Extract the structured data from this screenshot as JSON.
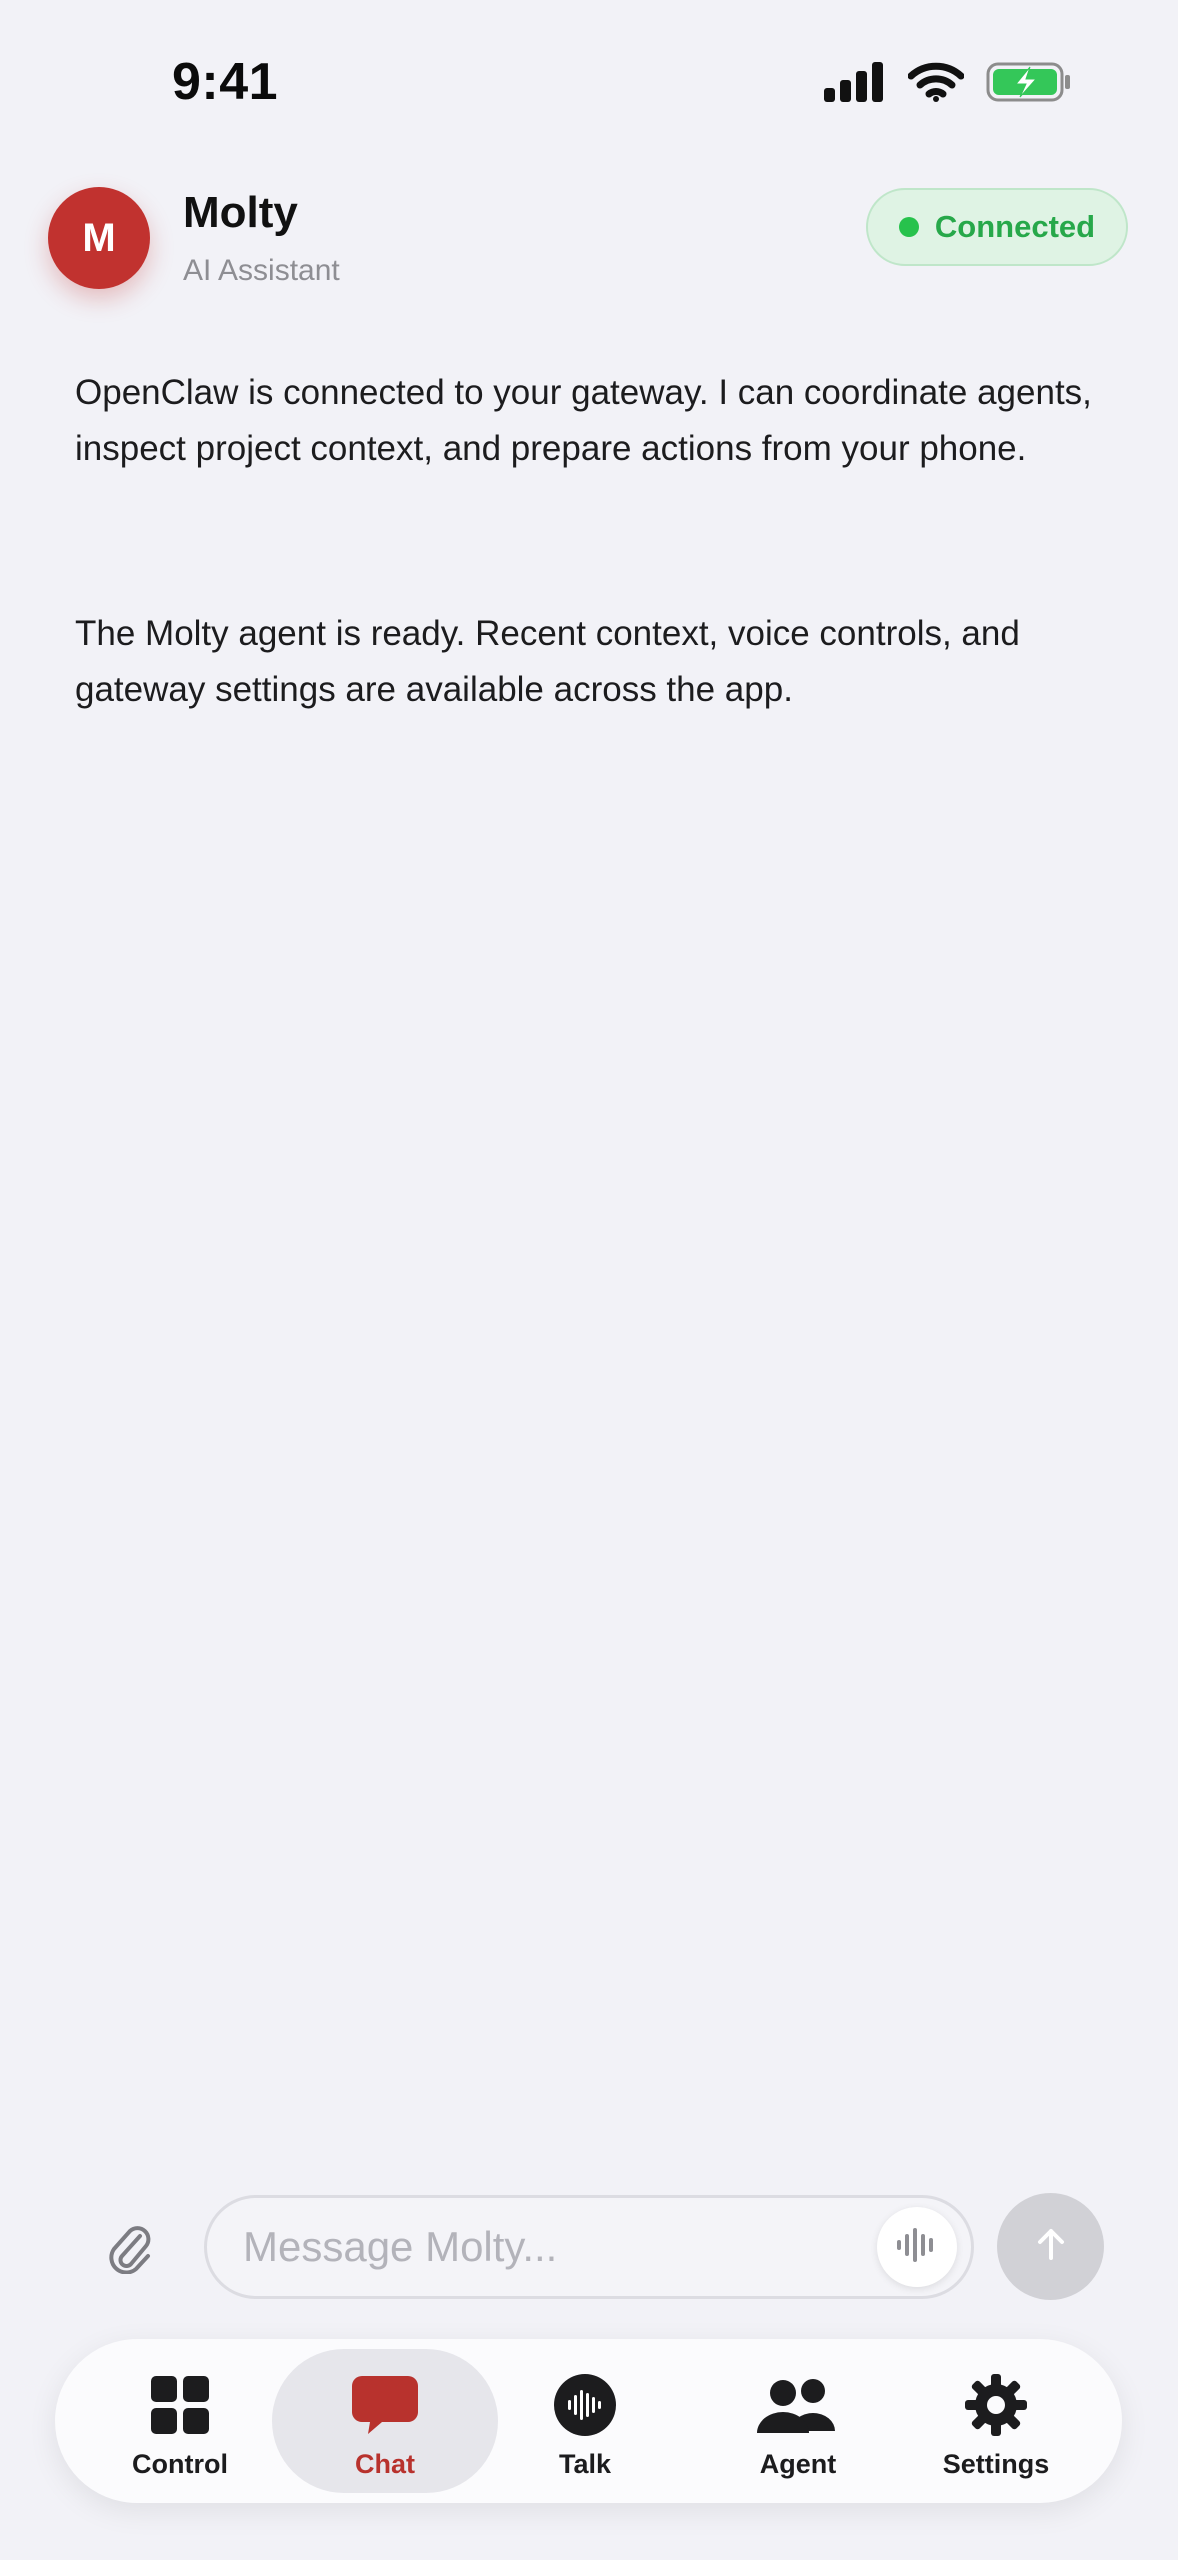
{
  "status_bar": {
    "time": "9:41",
    "icons": [
      "cellular-signal-icon",
      "wifi-icon",
      "battery-charging-icon"
    ]
  },
  "header": {
    "avatar_initial": "M",
    "name": "Molty",
    "subtitle": "AI Assistant",
    "status_label": "Connected"
  },
  "messages": [
    {
      "text": "OpenClaw is connected to your gateway. I can coordinate agents, inspect project context, and prepare actions from your phone."
    },
    {
      "text": "The Molty agent is ready. Recent context, voice controls, and gateway settings are available across the app."
    }
  ],
  "composer": {
    "placeholder": "Message Molty...",
    "value": "",
    "attach_icon": "paperclip-icon",
    "voice_icon": "waveform-icon",
    "send_icon": "arrow-up-icon"
  },
  "tabs": [
    {
      "label": "Control",
      "icon": "grid-icon",
      "active": false
    },
    {
      "label": "Chat",
      "icon": "chat-bubble-icon",
      "active": true
    },
    {
      "label": "Talk",
      "icon": "waveform-circle-icon",
      "active": false
    },
    {
      "label": "Agent",
      "icon": "people-icon",
      "active": false
    },
    {
      "label": "Settings",
      "icon": "gear-icon",
      "active": false
    }
  ],
  "colors": {
    "accent": "#c1322f",
    "active_tab_label": "#b8322d",
    "connected_green": "#27a84a",
    "background": "#f2f2f7"
  }
}
